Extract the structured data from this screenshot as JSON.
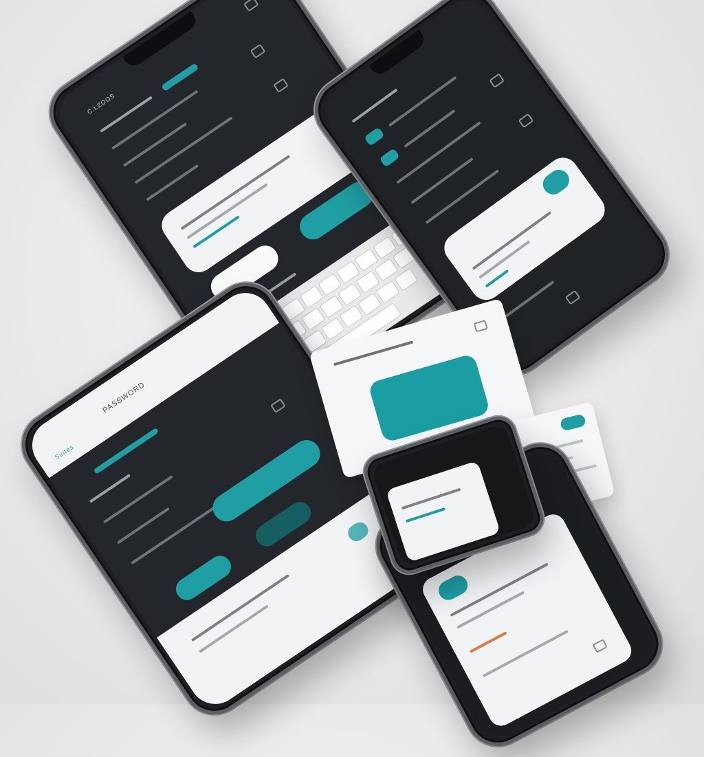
{
  "phone_a": {
    "status_time": "CL",
    "header": "C.LZOOS",
    "list_rows": [
      "",
      "",
      "",
      "",
      ""
    ],
    "dialog": {
      "label": "",
      "cancel_label": "",
      "confirm_label": ""
    },
    "keyboard_rows": 4
  },
  "phone_b": {
    "header": "",
    "dialog_label": ""
  },
  "phone_c": {
    "title": "PASSWORD",
    "brand": "Suites"
  },
  "accent_color": "#1f9fa3",
  "dark_color": "#23272b",
  "icons": [
    "chevron-icon",
    "battery-icon",
    "search-icon",
    "bell-icon",
    "settings-icon",
    "chat-icon"
  ]
}
